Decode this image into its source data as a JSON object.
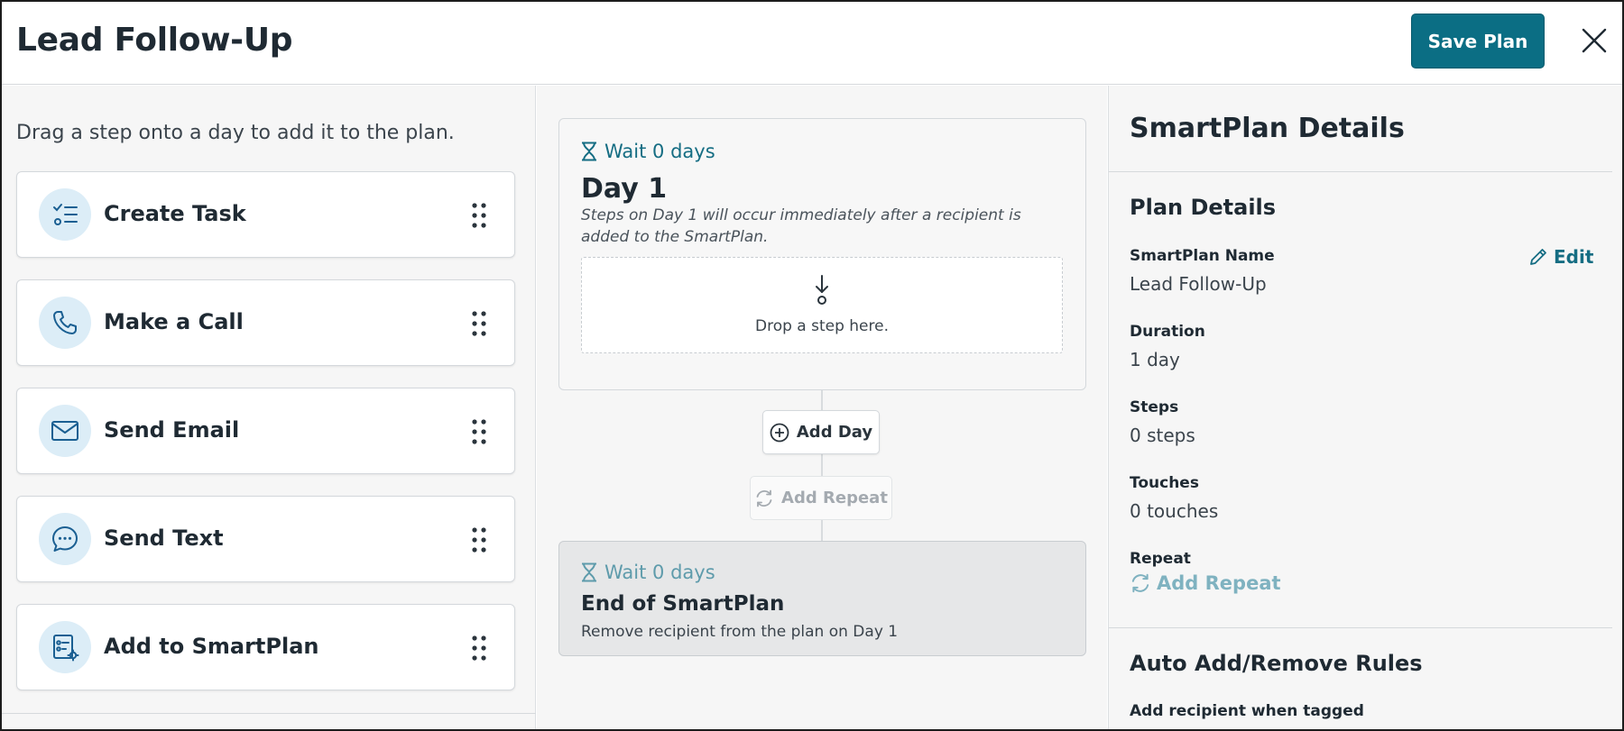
{
  "header": {
    "title": "Lead Follow-Up",
    "save_label": "Save Plan"
  },
  "palette": {
    "hint": "Drag a step onto a day to add it to the plan.",
    "steps": [
      {
        "label": "Create Task",
        "icon": "task-list-icon"
      },
      {
        "label": "Make a Call",
        "icon": "phone-icon"
      },
      {
        "label": "Send Email",
        "icon": "envelope-icon"
      },
      {
        "label": "Send Text",
        "icon": "chat-bubble-icon"
      },
      {
        "label": "Add to SmartPlan",
        "icon": "smartplan-icon"
      }
    ]
  },
  "timeline": {
    "day": {
      "wait": "Wait 0 days",
      "title": "Day 1",
      "description": "Steps on Day 1 will occur immediately after a recipient is added to the SmartPlan.",
      "drop_text": "Drop a step here."
    },
    "add_day_label": "Add Day",
    "add_repeat_label": "Add Repeat",
    "end": {
      "wait": "Wait 0 days",
      "title": "End of SmartPlan",
      "description": "Remove recipient from the plan on Day 1"
    }
  },
  "details": {
    "title": "SmartPlan Details",
    "plan_section": "Plan Details",
    "edit_label": "Edit",
    "name_label": "SmartPlan Name",
    "name_value": "Lead Follow-Up",
    "duration_label": "Duration",
    "duration_value": "1 day",
    "steps_label": "Steps",
    "steps_value": "0 steps",
    "touches_label": "Touches",
    "touches_value": "0 touches",
    "repeat_label": "Repeat",
    "add_repeat_label": "Add Repeat",
    "rules_section": "Auto Add/Remove Rules",
    "rules_add_label": "Add recipient when tagged"
  },
  "colors": {
    "accent": "#0b6e84",
    "link": "#156d83",
    "icon_bg": "#dcedf7",
    "disabled": "#a4aab0"
  }
}
